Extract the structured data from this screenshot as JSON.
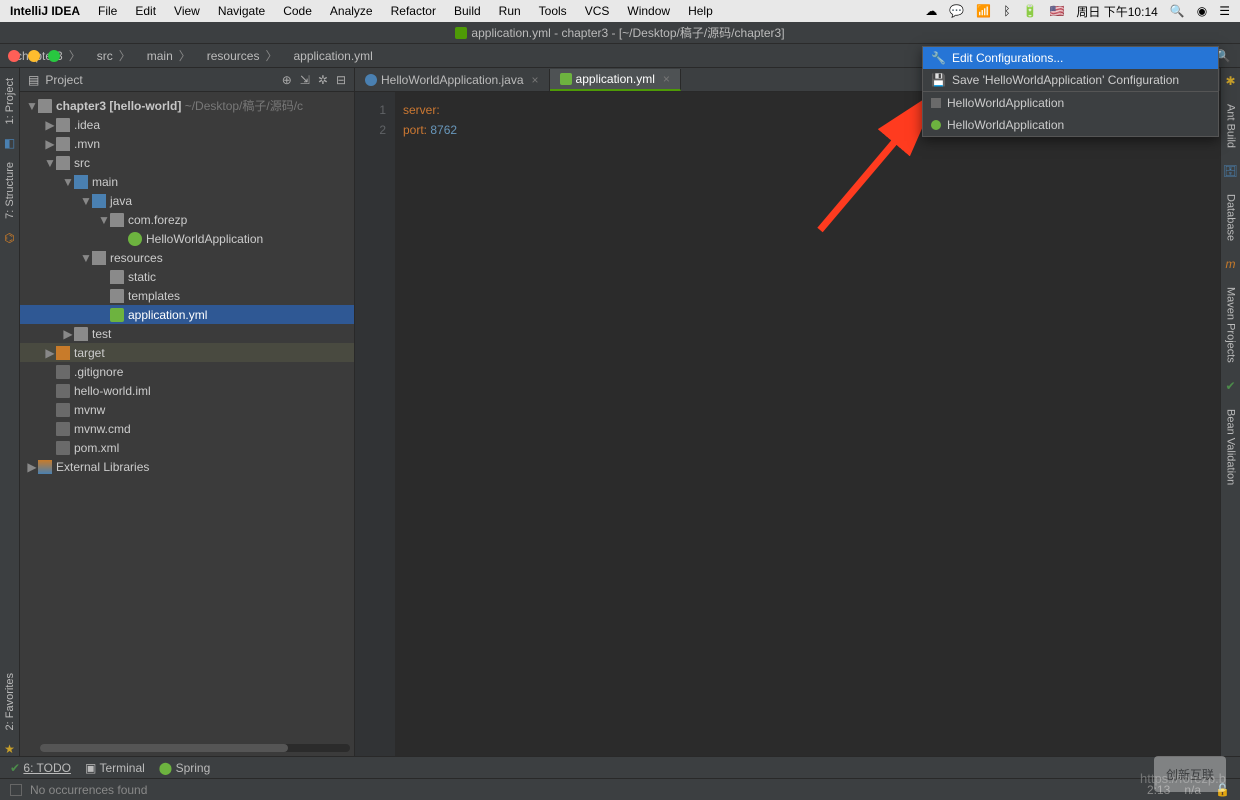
{
  "menubar": {
    "app": "IntelliJ IDEA",
    "items": [
      "File",
      "Edit",
      "View",
      "Navigate",
      "Code",
      "Analyze",
      "Refactor",
      "Build",
      "Run",
      "Tools",
      "VCS",
      "Window",
      "Help"
    ],
    "clock": "周日 下午10:14"
  },
  "window": {
    "title": "application.yml - chapter3 - [~/Desktop/稿子/源码/chapter3]"
  },
  "breadcrumbs": [
    {
      "label": "chapter3",
      "icon": "folder"
    },
    {
      "label": "src",
      "icon": "folder-src"
    },
    {
      "label": "main",
      "icon": "folder"
    },
    {
      "label": "resources",
      "icon": "folder-res"
    },
    {
      "label": "application.yml",
      "icon": "yml"
    }
  ],
  "run": {
    "selected": "HelloWorldApplication",
    "menu": [
      {
        "label": "Edit Configurations...",
        "icon": "wrench"
      },
      {
        "label": "Save 'HelloWorldApplication' Configuration",
        "icon": "save"
      },
      {
        "label": "HelloWorldApplication",
        "icon": "app"
      },
      {
        "label": "HelloWorldApplication",
        "icon": "spring"
      }
    ]
  },
  "sidebars": {
    "left": [
      "1: Project",
      "7: Structure"
    ],
    "left_bottom": [
      "2: Favorites"
    ],
    "right": [
      "Ant Build",
      "Database",
      "Maven Projects",
      "Bean Validation"
    ]
  },
  "project_panel": {
    "title": "Project",
    "root": {
      "name": "chapter3 [hello-world]",
      "path": "~/Desktop/稿子/源码/c"
    },
    "tree": [
      {
        "depth": 1,
        "chev": "▶",
        "icon": "folder",
        "label": ".idea"
      },
      {
        "depth": 1,
        "chev": "▶",
        "icon": "folder",
        "label": ".mvn"
      },
      {
        "depth": 1,
        "chev": "▼",
        "icon": "folder",
        "label": "src"
      },
      {
        "depth": 2,
        "chev": "▼",
        "icon": "folder-src",
        "label": "main"
      },
      {
        "depth": 3,
        "chev": "▼",
        "icon": "folder-src",
        "label": "java"
      },
      {
        "depth": 4,
        "chev": "▼",
        "icon": "folder",
        "label": "com.forezp"
      },
      {
        "depth": 5,
        "chev": " ",
        "icon": "spring",
        "label": "HelloWorldApplication"
      },
      {
        "depth": 3,
        "chev": "▼",
        "icon": "folder-res",
        "label": "resources"
      },
      {
        "depth": 4,
        "chev": " ",
        "icon": "folder",
        "label": "static"
      },
      {
        "depth": 4,
        "chev": " ",
        "icon": "folder",
        "label": "templates"
      },
      {
        "depth": 4,
        "chev": " ",
        "icon": "yml",
        "label": "application.yml",
        "selected": true
      },
      {
        "depth": 2,
        "chev": "▶",
        "icon": "folder",
        "label": "test"
      },
      {
        "depth": 1,
        "chev": "▶",
        "icon": "folder-orange",
        "label": "target",
        "sel2": true
      },
      {
        "depth": 1,
        "chev": " ",
        "icon": "file",
        "label": ".gitignore"
      },
      {
        "depth": 1,
        "chev": " ",
        "icon": "file",
        "label": "hello-world.iml"
      },
      {
        "depth": 1,
        "chev": " ",
        "icon": "file",
        "label": "mvnw"
      },
      {
        "depth": 1,
        "chev": " ",
        "icon": "file",
        "label": "mvnw.cmd"
      },
      {
        "depth": 1,
        "chev": " ",
        "icon": "file",
        "label": "pom.xml"
      }
    ],
    "ext_libs": "External Libraries"
  },
  "tabs": [
    {
      "label": "HelloWorldApplication.java",
      "icon": "java"
    },
    {
      "label": "application.yml",
      "icon": "yml",
      "active": true
    }
  ],
  "editor": {
    "lines": [
      {
        "n": "1",
        "tokens": [
          {
            "t": "server:",
            "c": "kw"
          }
        ]
      },
      {
        "n": "2",
        "tokens": [
          {
            "t": "  port: ",
            "c": "kw"
          },
          {
            "t": "8762",
            "c": "val"
          }
        ]
      }
    ]
  },
  "bottom_tools": [
    {
      "label": "6: TODO",
      "icon": "check"
    },
    {
      "label": "Terminal",
      "icon": "term"
    },
    {
      "label": "Spring",
      "icon": "spring"
    }
  ],
  "status": {
    "left": "No occurrences found",
    "pos": "2:13",
    "enc": "n/a"
  },
  "watermark": "https://forezp.b",
  "wm_logo": "创新互联"
}
